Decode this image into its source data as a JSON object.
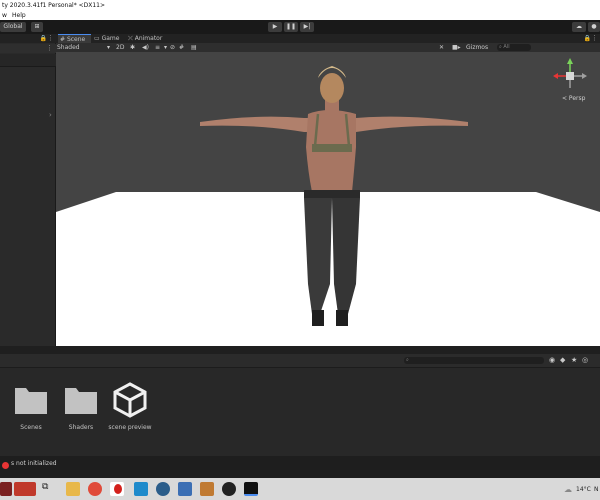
{
  "window": {
    "title": "ty 2020.3.41f1 Personal* <DX11>"
  },
  "menu": {
    "items": [
      "w",
      "Help"
    ]
  },
  "toolbar": {
    "global_label": "Global",
    "play_icon": "play-icon",
    "pause_icon": "pause-icon",
    "step_icon": "step-icon"
  },
  "scene_tabs": [
    "Scene",
    "Game",
    "Animator"
  ],
  "scene_toolbar": {
    "shading": "Shaded",
    "mode_2d": "2D",
    "gizmos": "Gizmos",
    "search_all": "All"
  },
  "viewport": {
    "persp_label": "< Persp"
  },
  "project": {
    "items": [
      {
        "label": "Scenes",
        "icon": "folder-icon"
      },
      {
        "label": "Shaders",
        "icon": "folder-icon"
      },
      {
        "label": "scene preview",
        "icon": "unity-logo-icon"
      }
    ]
  },
  "status": {
    "message": "s not initialized"
  },
  "taskbar": {
    "weather": "14°C",
    "extra": "N"
  },
  "colors": {
    "ground": "#ffffff",
    "sky": "#444444",
    "accent_red": "#e83535"
  }
}
